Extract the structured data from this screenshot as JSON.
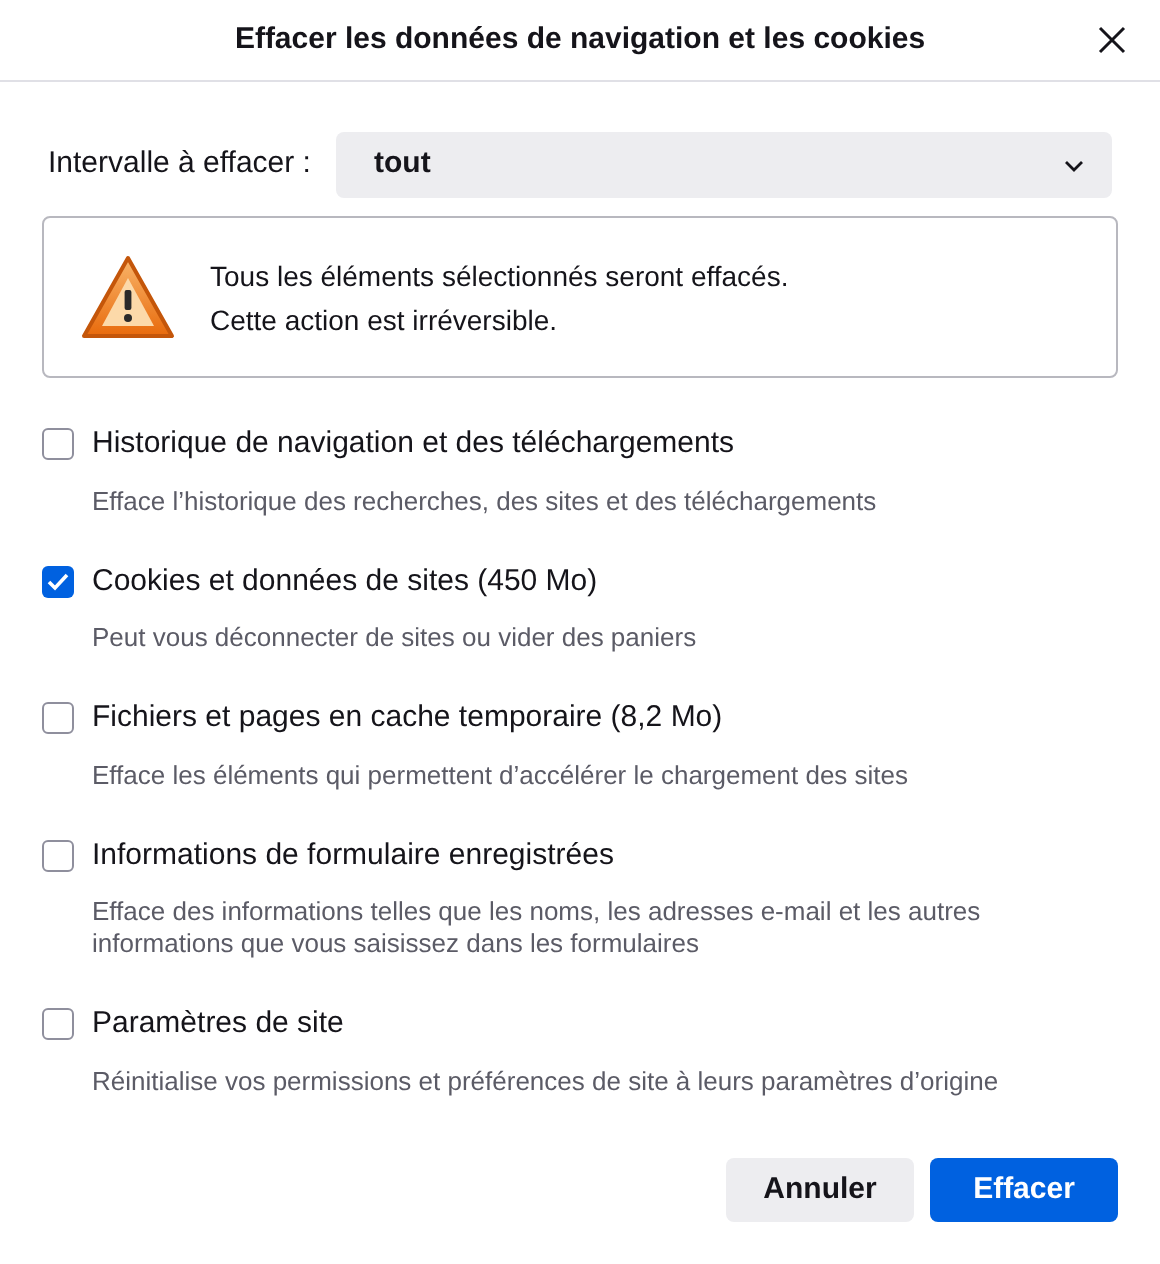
{
  "window": {
    "title": "Effacer les données de navigation et les cookies"
  },
  "range": {
    "label": "Intervalle à effacer :",
    "value": "tout"
  },
  "warning": {
    "lines": [
      "Tous les éléments sélectionnés seront effacés.",
      "Cette action est irréversible."
    ]
  },
  "options": [
    {
      "label": "Historique de navigation et des téléchargements",
      "description": "Efface l’historique des recherches, des sites et des téléchargements",
      "checked": false
    },
    {
      "label": "Cookies et données de sites (450 Mo)",
      "description": "Peut vous déconnecter de sites ou vider des paniers",
      "checked": true
    },
    {
      "label": "Fichiers et pages en cache temporaire (8,2 Mo)",
      "description": "Efface les éléments qui permettent d’accélérer le chargement des sites",
      "checked": false
    },
    {
      "label": "Informations de formulaire enregistrées",
      "description": "Efface des informations telles que les noms, les adresses e-mail et les autres informations que vous saisissez dans les formulaires",
      "checked": false
    },
    {
      "label": "Paramètres de site",
      "description": "Réinitialise vos permissions et préférences de site à leurs paramètres d’origine",
      "checked": false
    }
  ],
  "buttons": [
    {
      "label": "Annuler",
      "kind": "secondary"
    },
    {
      "label": "Effacer",
      "kind": "primary"
    }
  ]
}
